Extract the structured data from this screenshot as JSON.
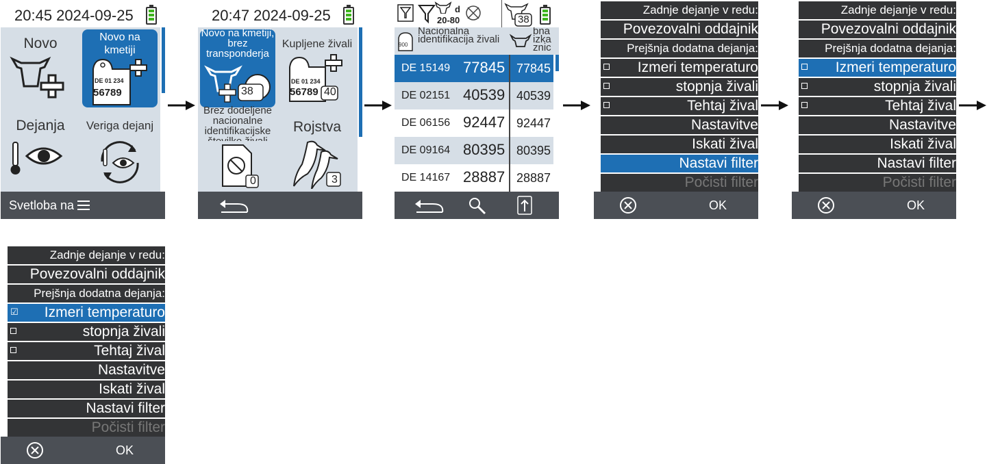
{
  "colors": {
    "accent": "#1e6fb4",
    "tile_bg": "#d6dee6",
    "bar": "#4b4f55",
    "menu": "#333436",
    "battery": "#3fb41e"
  },
  "screen1": {
    "time": "20:45 2024-09-25",
    "tiles": {
      "novo": "Novo",
      "novo_na_kmetiji": "Novo na kmetiji",
      "dejanja": "Dejanja",
      "veriga": "Veriga dejanj"
    },
    "tag_line1": "DE 01 234",
    "tag_line2": "56789",
    "bottom": "Svetloba na"
  },
  "screen2": {
    "time": "20:47 2024-09-25",
    "tiles": {
      "novo_brez": "Novo na kmetiji, brez transponderja",
      "kupljene": "Kupljene živali",
      "brez_id": "Brez dodeljene nacionalne identifikacijske številke živali",
      "rojstva": "Rojstva"
    },
    "badges": {
      "novo_brez": "38",
      "kupljene": "40",
      "brez_id": "0",
      "rojstva": "3"
    },
    "tag_line1": "DE 01 234",
    "tag_line2": "56789"
  },
  "screen3": {
    "filter_range": "20-80",
    "filter_unit": "d",
    "count_badge": "38",
    "header_left": "Nacionalna identifikacija živali",
    "header_right": "bna izka znic",
    "header_icon": "900",
    "rows": [
      {
        "c1": "DE 15149",
        "c2": "77845",
        "c3": "77845"
      },
      {
        "c1": "DE 02151",
        "c2": "40539",
        "c3": "40539"
      },
      {
        "c1": "DE 06156",
        "c2": "92447",
        "c3": "92447"
      },
      {
        "c1": "DE 09164",
        "c2": "80395",
        "c3": "80395"
      },
      {
        "c1": "DE 14167",
        "c2": "28887",
        "c3": "28887"
      }
    ]
  },
  "menu": {
    "header1": "Zadnje dejanje v redu:",
    "item_conn": "Povezovalni oddajnik",
    "header2": "Prejšnja dodatna dejanja:",
    "opt1": "Izmeri temperaturo",
    "opt2": "stopnja živali",
    "opt3": "Tehtaj žival",
    "settings": "Nastavitve",
    "search": "Iskati žival",
    "set_filter": "Nastavi filter",
    "clear_filter": "Počisti filter",
    "ok": "OK",
    "checked_mark": "☑"
  }
}
